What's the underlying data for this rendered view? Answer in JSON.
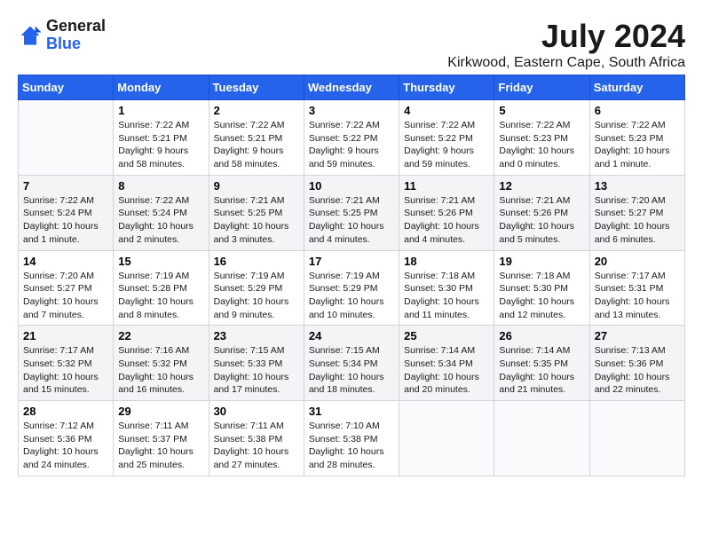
{
  "header": {
    "logo_line1": "General",
    "logo_line2": "Blue",
    "month_year": "July 2024",
    "location": "Kirkwood, Eastern Cape, South Africa"
  },
  "weekdays": [
    "Sunday",
    "Monday",
    "Tuesday",
    "Wednesday",
    "Thursday",
    "Friday",
    "Saturday"
  ],
  "weeks": [
    [
      {
        "day": "",
        "sunrise": "",
        "sunset": "",
        "daylight": ""
      },
      {
        "day": "1",
        "sunrise": "Sunrise: 7:22 AM",
        "sunset": "Sunset: 5:21 PM",
        "daylight": "Daylight: 9 hours and 58 minutes."
      },
      {
        "day": "2",
        "sunrise": "Sunrise: 7:22 AM",
        "sunset": "Sunset: 5:21 PM",
        "daylight": "Daylight: 9 hours and 58 minutes."
      },
      {
        "day": "3",
        "sunrise": "Sunrise: 7:22 AM",
        "sunset": "Sunset: 5:22 PM",
        "daylight": "Daylight: 9 hours and 59 minutes."
      },
      {
        "day": "4",
        "sunrise": "Sunrise: 7:22 AM",
        "sunset": "Sunset: 5:22 PM",
        "daylight": "Daylight: 9 hours and 59 minutes."
      },
      {
        "day": "5",
        "sunrise": "Sunrise: 7:22 AM",
        "sunset": "Sunset: 5:23 PM",
        "daylight": "Daylight: 10 hours and 0 minutes."
      },
      {
        "day": "6",
        "sunrise": "Sunrise: 7:22 AM",
        "sunset": "Sunset: 5:23 PM",
        "daylight": "Daylight: 10 hours and 1 minute."
      }
    ],
    [
      {
        "day": "7",
        "sunrise": "Sunrise: 7:22 AM",
        "sunset": "Sunset: 5:24 PM",
        "daylight": "Daylight: 10 hours and 1 minute."
      },
      {
        "day": "8",
        "sunrise": "Sunrise: 7:22 AM",
        "sunset": "Sunset: 5:24 PM",
        "daylight": "Daylight: 10 hours and 2 minutes."
      },
      {
        "day": "9",
        "sunrise": "Sunrise: 7:21 AM",
        "sunset": "Sunset: 5:25 PM",
        "daylight": "Daylight: 10 hours and 3 minutes."
      },
      {
        "day": "10",
        "sunrise": "Sunrise: 7:21 AM",
        "sunset": "Sunset: 5:25 PM",
        "daylight": "Daylight: 10 hours and 4 minutes."
      },
      {
        "day": "11",
        "sunrise": "Sunrise: 7:21 AM",
        "sunset": "Sunset: 5:26 PM",
        "daylight": "Daylight: 10 hours and 4 minutes."
      },
      {
        "day": "12",
        "sunrise": "Sunrise: 7:21 AM",
        "sunset": "Sunset: 5:26 PM",
        "daylight": "Daylight: 10 hours and 5 minutes."
      },
      {
        "day": "13",
        "sunrise": "Sunrise: 7:20 AM",
        "sunset": "Sunset: 5:27 PM",
        "daylight": "Daylight: 10 hours and 6 minutes."
      }
    ],
    [
      {
        "day": "14",
        "sunrise": "Sunrise: 7:20 AM",
        "sunset": "Sunset: 5:27 PM",
        "daylight": "Daylight: 10 hours and 7 minutes."
      },
      {
        "day": "15",
        "sunrise": "Sunrise: 7:19 AM",
        "sunset": "Sunset: 5:28 PM",
        "daylight": "Daylight: 10 hours and 8 minutes."
      },
      {
        "day": "16",
        "sunrise": "Sunrise: 7:19 AM",
        "sunset": "Sunset: 5:29 PM",
        "daylight": "Daylight: 10 hours and 9 minutes."
      },
      {
        "day": "17",
        "sunrise": "Sunrise: 7:19 AM",
        "sunset": "Sunset: 5:29 PM",
        "daylight": "Daylight: 10 hours and 10 minutes."
      },
      {
        "day": "18",
        "sunrise": "Sunrise: 7:18 AM",
        "sunset": "Sunset: 5:30 PM",
        "daylight": "Daylight: 10 hours and 11 minutes."
      },
      {
        "day": "19",
        "sunrise": "Sunrise: 7:18 AM",
        "sunset": "Sunset: 5:30 PM",
        "daylight": "Daylight: 10 hours and 12 minutes."
      },
      {
        "day": "20",
        "sunrise": "Sunrise: 7:17 AM",
        "sunset": "Sunset: 5:31 PM",
        "daylight": "Daylight: 10 hours and 13 minutes."
      }
    ],
    [
      {
        "day": "21",
        "sunrise": "Sunrise: 7:17 AM",
        "sunset": "Sunset: 5:32 PM",
        "daylight": "Daylight: 10 hours and 15 minutes."
      },
      {
        "day": "22",
        "sunrise": "Sunrise: 7:16 AM",
        "sunset": "Sunset: 5:32 PM",
        "daylight": "Daylight: 10 hours and 16 minutes."
      },
      {
        "day": "23",
        "sunrise": "Sunrise: 7:15 AM",
        "sunset": "Sunset: 5:33 PM",
        "daylight": "Daylight: 10 hours and 17 minutes."
      },
      {
        "day": "24",
        "sunrise": "Sunrise: 7:15 AM",
        "sunset": "Sunset: 5:34 PM",
        "daylight": "Daylight: 10 hours and 18 minutes."
      },
      {
        "day": "25",
        "sunrise": "Sunrise: 7:14 AM",
        "sunset": "Sunset: 5:34 PM",
        "daylight": "Daylight: 10 hours and 20 minutes."
      },
      {
        "day": "26",
        "sunrise": "Sunrise: 7:14 AM",
        "sunset": "Sunset: 5:35 PM",
        "daylight": "Daylight: 10 hours and 21 minutes."
      },
      {
        "day": "27",
        "sunrise": "Sunrise: 7:13 AM",
        "sunset": "Sunset: 5:36 PM",
        "daylight": "Daylight: 10 hours and 22 minutes."
      }
    ],
    [
      {
        "day": "28",
        "sunrise": "Sunrise: 7:12 AM",
        "sunset": "Sunset: 5:36 PM",
        "daylight": "Daylight: 10 hours and 24 minutes."
      },
      {
        "day": "29",
        "sunrise": "Sunrise: 7:11 AM",
        "sunset": "Sunset: 5:37 PM",
        "daylight": "Daylight: 10 hours and 25 minutes."
      },
      {
        "day": "30",
        "sunrise": "Sunrise: 7:11 AM",
        "sunset": "Sunset: 5:38 PM",
        "daylight": "Daylight: 10 hours and 27 minutes."
      },
      {
        "day": "31",
        "sunrise": "Sunrise: 7:10 AM",
        "sunset": "Sunset: 5:38 PM",
        "daylight": "Daylight: 10 hours and 28 minutes."
      },
      {
        "day": "",
        "sunrise": "",
        "sunset": "",
        "daylight": ""
      },
      {
        "day": "",
        "sunrise": "",
        "sunset": "",
        "daylight": ""
      },
      {
        "day": "",
        "sunrise": "",
        "sunset": "",
        "daylight": ""
      }
    ]
  ]
}
